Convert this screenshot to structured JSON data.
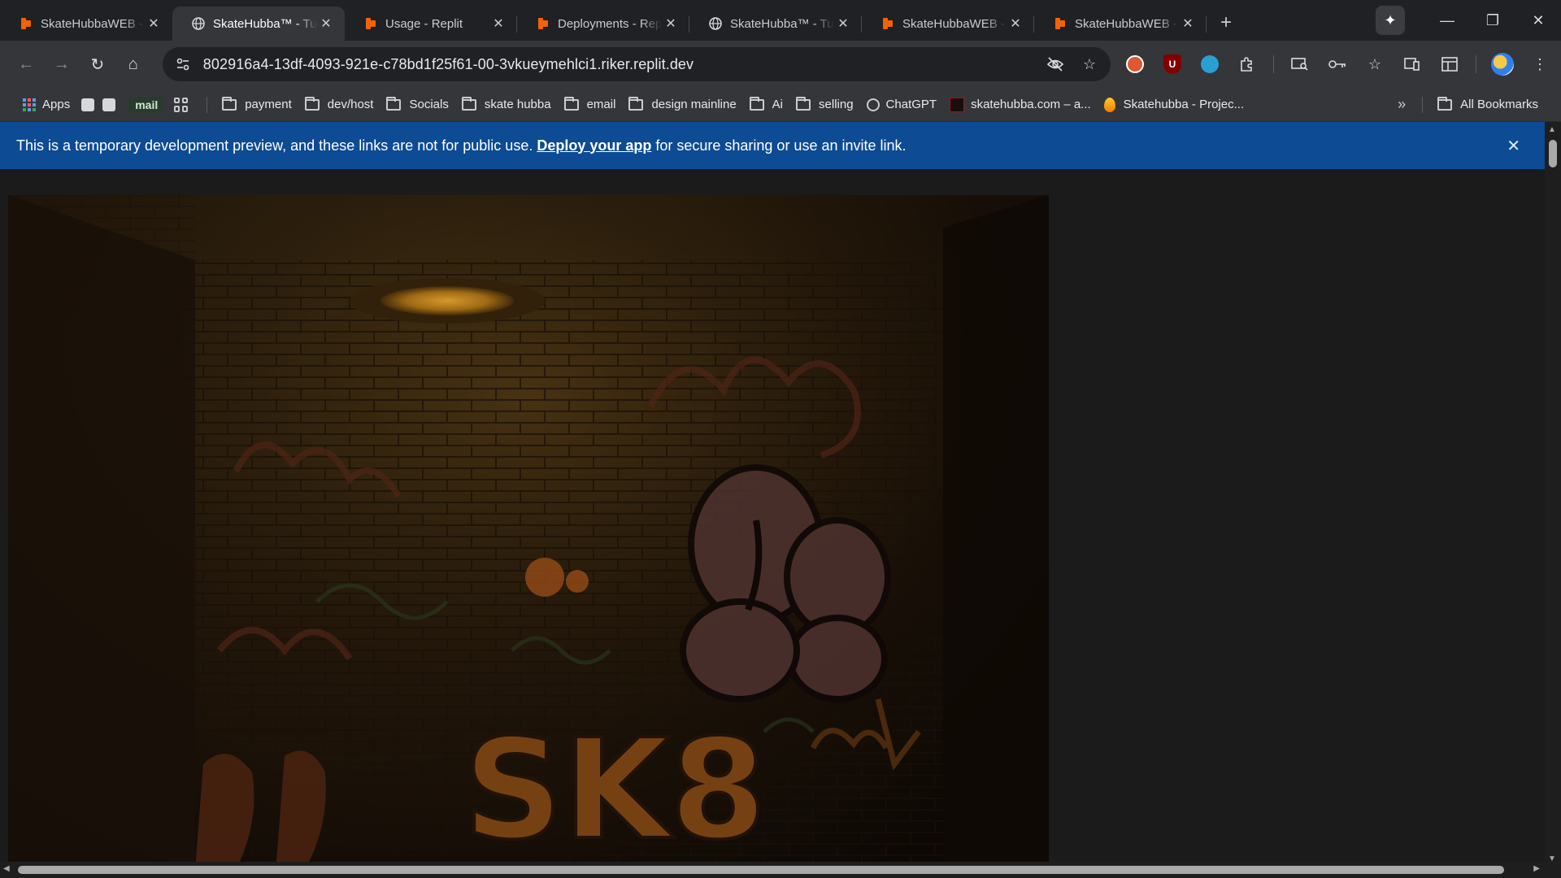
{
  "tabs": [
    {
      "title": "SkateHubbaWEB - Replit",
      "icon": "replit-icon",
      "active": false
    },
    {
      "title": "SkateHubba™ - Turn",
      "icon": "globe-icon",
      "active": true
    },
    {
      "title": "Usage - Replit",
      "icon": "replit-icon",
      "active": false
    },
    {
      "title": "Deployments - Replit",
      "icon": "replit-icon",
      "active": false
    },
    {
      "title": "SkateHubba™ - Turn",
      "icon": "globe-icon",
      "active": false
    },
    {
      "title": "SkateHubbaWEB - Replit",
      "icon": "replit-icon",
      "active": false
    },
    {
      "title": "SkateHubbaWEB - Replit",
      "icon": "replit-icon",
      "active": false
    }
  ],
  "window": {
    "new_tab": "+",
    "gemini": "✦",
    "minimize": "—",
    "restore": "❐",
    "close": "✕"
  },
  "toolbar": {
    "url": "802916a4-13df-4093-921e-c78bd1f25f61-00-3vkueymehlci1.riker.replit.dev",
    "back": "←",
    "forward": "→",
    "reload": "↻",
    "home": "⌂"
  },
  "bookmarks": {
    "apps": "Apps",
    "mail": "mail",
    "folders": [
      "payment",
      "dev/host",
      "Socials",
      "skate hubba",
      "email",
      "design mainline",
      "Ai",
      "selling"
    ],
    "chatgpt": "ChatGPT",
    "skatehubba_com": "skatehubba.com – a...",
    "skatehubba_project": "Skatehubba - Projec...",
    "more": "»",
    "all": "All Bookmarks"
  },
  "banner": {
    "text_before": "This is a temporary development preview, and these links are not for public use.",
    "link": "Deploy your app",
    "text_after": "for secure sharing or use an invite link.",
    "close": "✕"
  },
  "hero": {
    "graffiti_tag": "SK8"
  },
  "colors": {
    "banner_bg": "#0d4b94",
    "tab_bar": "#202124",
    "toolbar": "#35363a",
    "replit_orange": "#f26207"
  }
}
